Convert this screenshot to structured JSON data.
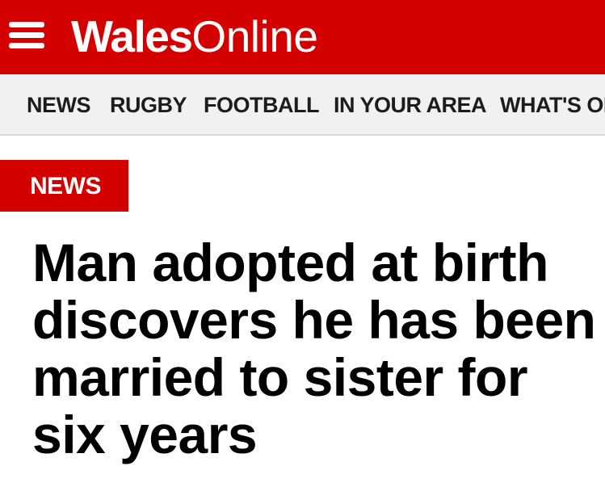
{
  "header": {
    "menu_icon": "hamburger-menu-icon",
    "logo_part1": "Wales",
    "logo_part2": "Online",
    "brand_color": "#d40000"
  },
  "nav": {
    "items": [
      {
        "label": "NEWS"
      },
      {
        "label": "RUGBY"
      },
      {
        "label": "FOOTBALL"
      },
      {
        "label": "IN YOUR AREA"
      },
      {
        "label": "WHAT'S ON"
      }
    ]
  },
  "article": {
    "section": "NEWS",
    "headline": "Man adopted at birth discovers he has been married to sister for six years"
  }
}
